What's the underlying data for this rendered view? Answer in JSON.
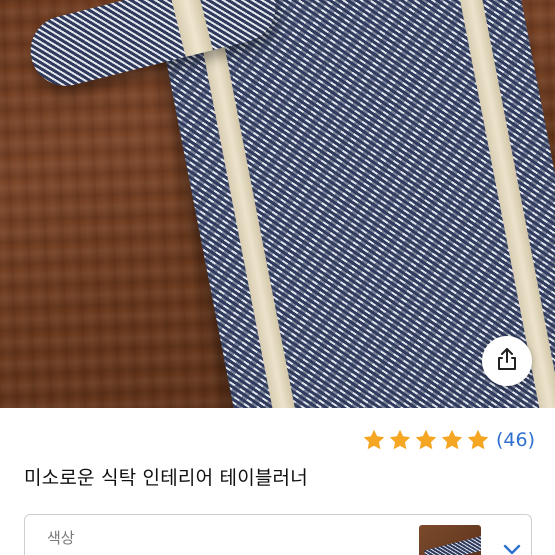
{
  "product": {
    "title": "미소로운 식탁 인테리어 테이블러너",
    "rating": {
      "stars": 5,
      "review_count": "(46)",
      "star_color": "#f5a623"
    },
    "option": {
      "label": "색상"
    }
  },
  "icons": {
    "share": "share-icon",
    "star": "star-icon",
    "chevron": "chevron-down-icon"
  },
  "colors": {
    "link": "#2f6fcf",
    "text": "#111111",
    "muted": "#7a7a7a"
  }
}
